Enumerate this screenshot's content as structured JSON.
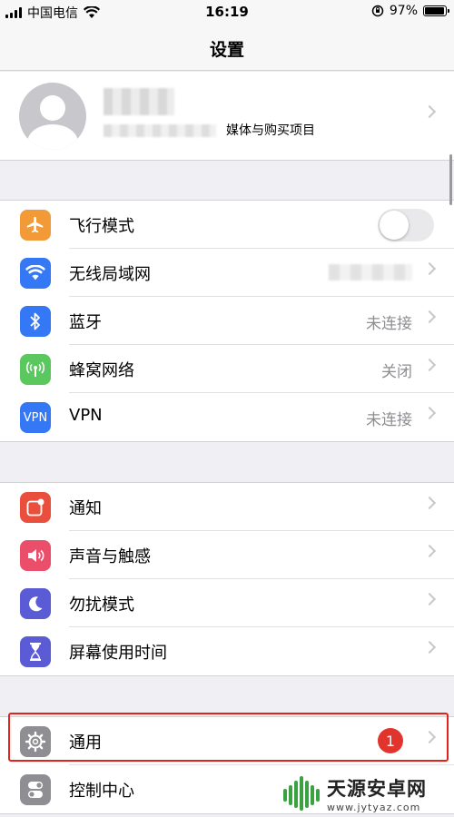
{
  "status_bar": {
    "carrier": "中国电信",
    "time": "16:19",
    "battery": "97%",
    "battery_level": 0.97
  },
  "nav": {
    "title": "设置"
  },
  "profile": {
    "subtitle": "媒体与购买项目"
  },
  "groups": {
    "connectivity": [
      {
        "label": "飞行模式",
        "value": "",
        "icon": "airplane-icon",
        "color": "#f19a37"
      },
      {
        "label": "无线局域网",
        "value": "",
        "icon": "wifi-icon",
        "color": "#3478f6"
      },
      {
        "label": "蓝牙",
        "value": "未连接",
        "icon": "bluetooth-icon",
        "color": "#3478f6"
      },
      {
        "label": "蜂窝网络",
        "value": "关闭",
        "icon": "cellular-icon",
        "color": "#5ac85f"
      },
      {
        "label": "VPN",
        "value": "未连接",
        "icon": "vpn-icon",
        "icon_text": "VPN",
        "color": "#3478f6"
      }
    ],
    "alerts": [
      {
        "label": "通知",
        "icon": "notifications-icon",
        "color": "#ea4e3d"
      },
      {
        "label": "声音与触感",
        "icon": "sound-icon",
        "color": "#ea4e6b"
      },
      {
        "label": "勿扰模式",
        "icon": "moon-icon",
        "color": "#5b5bd6"
      },
      {
        "label": "屏幕使用时间",
        "icon": "hourglass-icon",
        "color": "#5b5bd6"
      }
    ],
    "general": [
      {
        "label": "通用",
        "badge": "1",
        "icon": "gear-icon",
        "color": "#8e8e93"
      },
      {
        "label": "控制中心",
        "icon": "control-center-icon",
        "color": "#8e8e93"
      }
    ]
  },
  "watermark": {
    "name": "天源安卓网",
    "url": "www.jytyaz.com"
  }
}
